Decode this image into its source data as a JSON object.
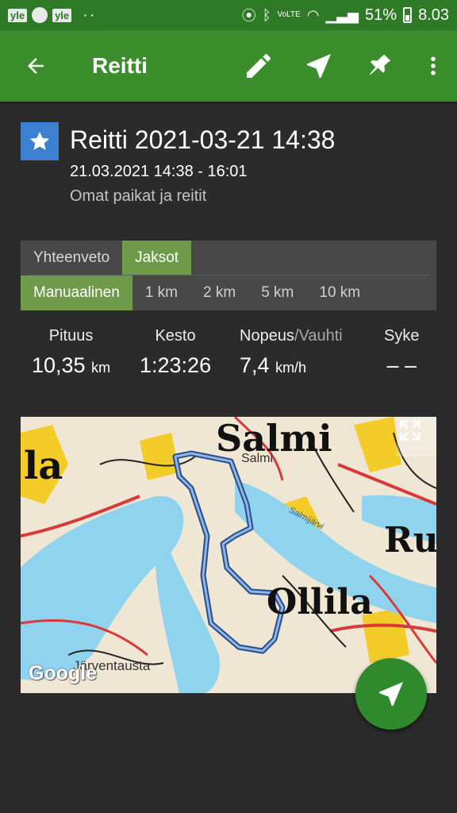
{
  "status_bar": {
    "badges": [
      "yle",
      "yle"
    ],
    "dots": "··",
    "volte": "VoLTE",
    "battery_percent": "51%",
    "time": "8.03"
  },
  "app_bar": {
    "title": "Reitti",
    "icons": [
      "arrow-back-icon",
      "pencil-icon",
      "navigation-arrow-icon",
      "pin-icon",
      "more-vert-icon"
    ]
  },
  "route": {
    "title": "Reitti 2021-03-21 14:38",
    "date_range": "21.03.2021 14:38 - 16:01",
    "folder": "Omat paikat ja reitit",
    "favorite_icon": "star-icon",
    "favorite_color": "#3d7fd1"
  },
  "tabs": {
    "items": [
      "Yhteenveto",
      "Jaksot"
    ],
    "active_index": 1,
    "sub_items": [
      "Manuaalinen",
      "1 km",
      "2 km",
      "5 km",
      "10 km"
    ],
    "sub_active_index": 0
  },
  "stats": {
    "length": {
      "label": "Pituus",
      "value": "10,35",
      "unit": "km"
    },
    "duration": {
      "label": "Kesto",
      "value": "1:23:26"
    },
    "speed": {
      "label": "Nopeus",
      "label_secondary": "/Vauhti",
      "value": "7,4",
      "unit": "km/h"
    },
    "heart_rate": {
      "label": "Syke",
      "value": "– –"
    }
  },
  "map": {
    "labels": {
      "salmi_big": "Salmi",
      "salmi_small": "Salmi",
      "ollila": "Ollila",
      "ru": "Ru",
      "la": "la",
      "salmijarvi": "Salmijärvi",
      "jarventausta": "Järventausta"
    },
    "attribution": "Google",
    "fullscreen_icon": "fullscreen-icon"
  },
  "fab": {
    "icon": "navigation-arrow-icon"
  },
  "colors": {
    "toolbar": "#3b8e2b",
    "status_bar": "#2f7a26",
    "active_tab": "#6e9a4a",
    "route_line": "#264e8a"
  }
}
